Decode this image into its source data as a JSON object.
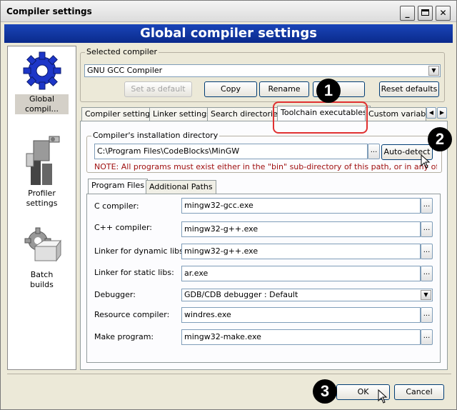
{
  "window": {
    "title": "Compiler settings"
  },
  "titlebar_buttons": {
    "minimize": "_",
    "close": "✕"
  },
  "header": {
    "title": "Global compiler settings"
  },
  "sidebar": {
    "items": [
      {
        "label_line1": "Global",
        "label_line2": "compil...",
        "icon": "gear-icon",
        "selected": true
      },
      {
        "label_line1": "Profiler",
        "label_line2": "settings",
        "icon": "profiler-icon",
        "selected": false
      },
      {
        "label_line1": "Batch",
        "label_line2": "builds",
        "icon": "batch-builds-icon",
        "selected": false
      }
    ]
  },
  "selected_compiler": {
    "legend": "Selected compiler",
    "value": "GNU GCC Compiler"
  },
  "compiler_buttons": {
    "set_default": "Set as default",
    "copy": "Copy",
    "rename": "Rename",
    "delete": "",
    "reset": "Reset defaults"
  },
  "tabs": [
    {
      "label": "Compiler settings"
    },
    {
      "label": "Linker settings"
    },
    {
      "label": "Search directories"
    },
    {
      "label": "Toolchain executables"
    },
    {
      "label": "Custom variable"
    }
  ],
  "tab_scroll": {
    "left": "◀",
    "right": "▶"
  },
  "installation": {
    "legend": "Compiler's installation directory",
    "path": "C:\\Program Files\\CodeBlocks\\MinGW",
    "browse": "...",
    "autodetect": "Auto-detect",
    "note": "NOTE: All programs must exist either in the \"bin\" sub-directory of this path, or in any of the"
  },
  "subtabs": [
    {
      "label": "Program Files"
    },
    {
      "label": "Additional Paths"
    }
  ],
  "programs": {
    "c_compiler": {
      "label": "C compiler:",
      "value": "mingw32-gcc.exe"
    },
    "cpp_compiler": {
      "label": "C++ compiler:",
      "value": "mingw32-g++.exe"
    },
    "linker_dynamic": {
      "label": "Linker for dynamic libs:",
      "value": "mingw32-g++.exe"
    },
    "linker_static": {
      "label": "Linker for static libs:",
      "value": "ar.exe"
    },
    "debugger": {
      "label": "Debugger:",
      "value": "GDB/CDB debugger : Default"
    },
    "resource_compiler": {
      "label": "Resource compiler:",
      "value": "windres.exe"
    },
    "make_program": {
      "label": "Make program:",
      "value": "mingw32-make.exe"
    },
    "browse": "..."
  },
  "footer": {
    "ok": "OK",
    "cancel": "Cancel"
  },
  "callouts": {
    "one": "1",
    "two": "2",
    "three": "3"
  },
  "colors": {
    "header": "#0a2a8c",
    "callout_box": "#e03030",
    "note": "#a01010"
  }
}
